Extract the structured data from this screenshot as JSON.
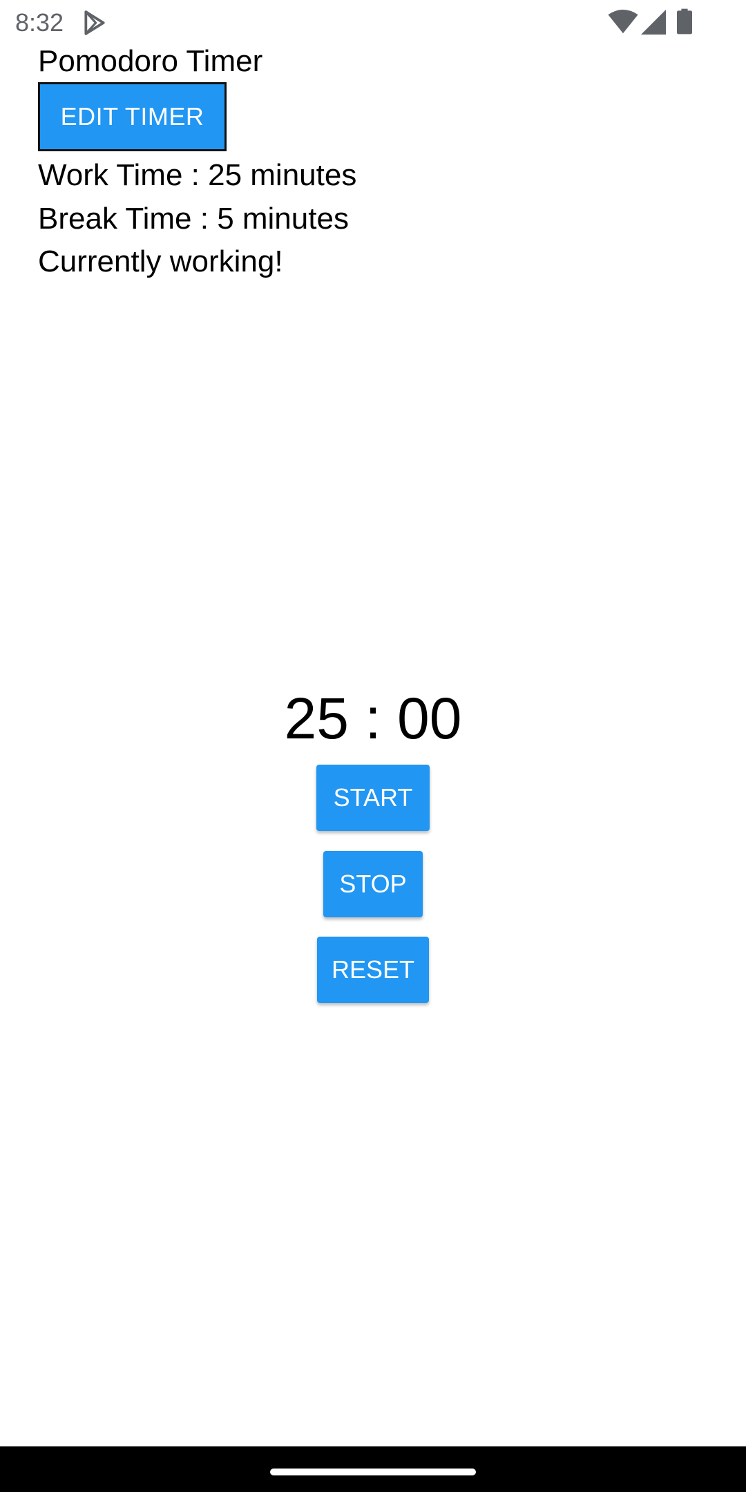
{
  "status_bar": {
    "time": "8:32",
    "icons": [
      "play-store-icon",
      "wifi-icon",
      "signal-icon",
      "battery-icon"
    ]
  },
  "header": {
    "title": "Pomodoro Timer",
    "edit_button_label": "EDIT TIMER"
  },
  "info": {
    "work_time": "Work Time : 25 minutes",
    "break_time": "Break Time : 5 minutes",
    "status": "Currently working!"
  },
  "timer": {
    "display": "25 : 00",
    "start_label": "START",
    "stop_label": "STOP",
    "reset_label": "RESET"
  },
  "colors": {
    "accent": "#2196f3",
    "background": "#ffffff",
    "text": "#000000",
    "nav_bar": "#000000"
  }
}
